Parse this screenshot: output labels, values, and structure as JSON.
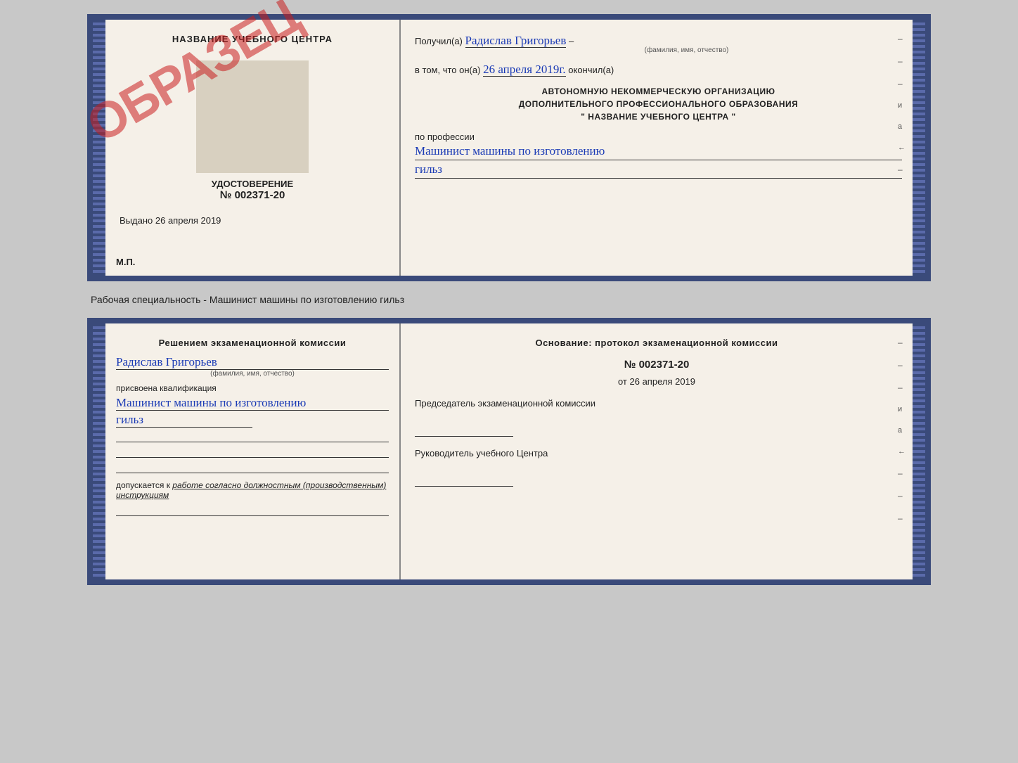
{
  "document_top": {
    "left": {
      "title": "НАЗВАНИЕ УЧЕБНОГО ЦЕНТРА",
      "stamp_text": "ОБРАЗЕЦ",
      "udostoverenie_label": "УДОСТОВЕРЕНИЕ",
      "number": "№ 002371-20",
      "vydano_label": "Выдано",
      "vydano_date": "26 апреля 2019",
      "mp_label": "М.П."
    },
    "right": {
      "poluchil_label": "Получил(а)",
      "name_handwritten": "Радислав Григорьев",
      "name_sub": "(фамилия, имя, отчество)",
      "vtom_label": "в том, что он(а)",
      "date_handwritten": "26 апреля 2019г.",
      "okonchil_label": "окончил(а)",
      "org_line1": "АВТОНОМНУЮ НЕКОММЕРЧЕСКУЮ ОРГАНИЗАЦИЮ",
      "org_line2": "ДОПОЛНИТЕЛЬНОГО ПРОФЕССИОНАЛЬНОГО ОБРАЗОВАНИЯ",
      "org_line3": "\"  НАЗВАНИЕ УЧЕБНОГО ЦЕНТРА  \"",
      "po_professii_label": "по профессии",
      "profession_handwritten": "Машинист машины по изготовлению",
      "profession_line2": "гильз",
      "dashes": [
        "-",
        "-",
        "-",
        "и",
        "а",
        "←",
        "-"
      ]
    }
  },
  "separator": {
    "text": "Рабочая специальность - Машинист машины по изготовлению гильз"
  },
  "document_bottom": {
    "left": {
      "title": "Решением  экзаменационной  комиссии",
      "name_handwritten": "Радислав Григорьев",
      "name_sub": "(фамилия, имя, отчество)",
      "prisvoena_label": "присвоена квалификация",
      "qualification_line1": "Машинист машины по изготовлению",
      "qualification_line2": "гильз",
      "dopuskaetsya_label": "допускается к",
      "dopuskaetsya_text": "работе согласно должностным (производственным) инструкциям"
    },
    "right": {
      "osnovanie_title": "Основание: протокол экзаменационной  комиссии",
      "protocol_number": "№  002371-20",
      "ot_label": "от",
      "ot_date": "26 апреля 2019",
      "predsedatel_label": "Председатель экзаменационной комиссии",
      "rukovoditel_label": "Руководитель учебного Центра",
      "dashes": [
        "-",
        "-",
        "-",
        "и",
        "а",
        "←",
        "-",
        "-",
        "-"
      ]
    }
  }
}
